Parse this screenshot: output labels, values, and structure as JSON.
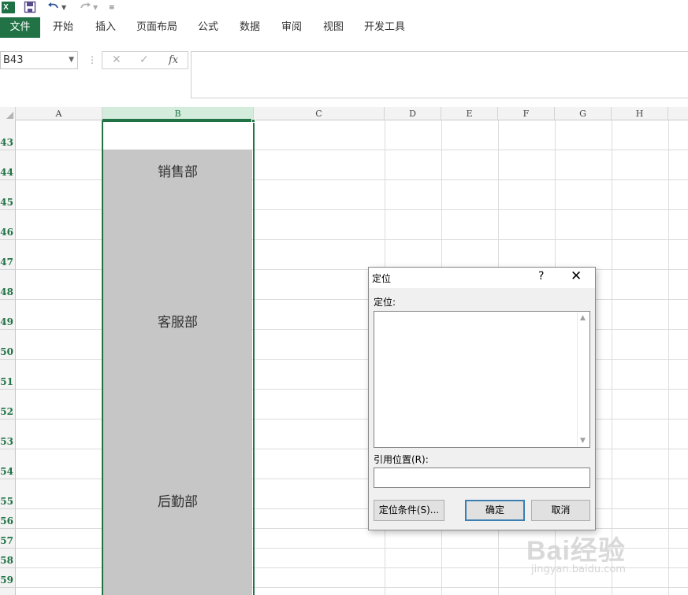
{
  "quick_access": {
    "app_icon": "excel-logo",
    "app_icon_letter": "X",
    "save_icon": "save-icon",
    "undo_icon": "undo-icon",
    "redo_icon": "redo-icon",
    "customize_icon": "customize-qat-icon"
  },
  "ribbon": {
    "file_tab": "文件",
    "tabs": [
      "开始",
      "插入",
      "页面布局",
      "公式",
      "数据",
      "审阅",
      "视图",
      "开发工具"
    ]
  },
  "formula_bar": {
    "name_box": "B43",
    "cancel_icon": "✕",
    "enter_icon": "✓",
    "fx_label": "fx",
    "formula": ""
  },
  "grid": {
    "columns": [
      "A",
      "B",
      "C",
      "D",
      "E",
      "F",
      "G",
      "H"
    ],
    "selected_column": "B",
    "rows": [
      "43",
      "44",
      "45",
      "46",
      "47",
      "48",
      "49",
      "50",
      "51",
      "52",
      "53",
      "54",
      "55",
      "56",
      "57",
      "58",
      "59"
    ],
    "cells": {
      "B44": "销售部",
      "B49": "客服部",
      "B55": "后勤部"
    }
  },
  "dialog": {
    "title": "定位",
    "help": "?",
    "close": "✕",
    "goto_label": "定位:",
    "reference_label": "引用位置(R):",
    "reference_value": "",
    "special_button": "定位条件(S)...",
    "ok_button": "确定",
    "cancel_button": "取消"
  },
  "watermark": {
    "logo": "Bai经验",
    "url": "jingyan.baidu.com"
  },
  "colors": {
    "excel_green": "#217346",
    "selection_fill": "#c6c6c6",
    "header_fill": "#f3f3f3",
    "selected_header_fill": "#d3ecdc"
  }
}
